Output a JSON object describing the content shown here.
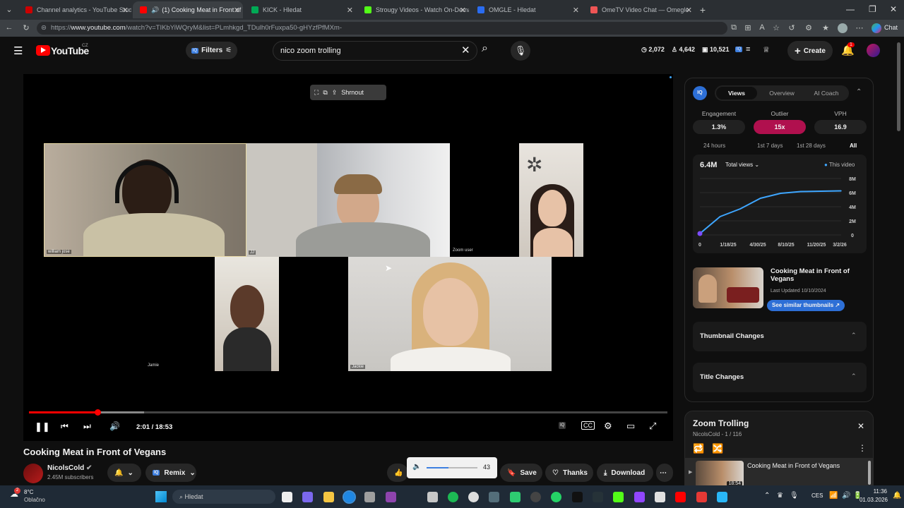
{
  "browser": {
    "tabs": [
      {
        "label": "Channel analytics - YouTube Studio",
        "color": "#c00"
      },
      {
        "label": "(1) Cooking Meat in Front of V",
        "color": "#f00",
        "active": true
      },
      {
        "label": "KICK - Hledat",
        "color": "#0a5"
      },
      {
        "label": "Strougy Videos - Watch On-Dema",
        "color": "#53fc18"
      },
      {
        "label": "OMGLE - Hledat",
        "color": "#2a6cf0"
      },
      {
        "label": "OmeTV Video Chat — Omegle",
        "color": "#e55"
      }
    ],
    "url_prefix": "https://",
    "url_host": "www.youtube.com",
    "url_path": "/watch?v=TIKbYiWQryM&list=PLmhkgd_TDulh0rFuxpa50-gHYzfPfMXm-",
    "chat_label": "Chat"
  },
  "yt": {
    "logo": "YouTube",
    "country": "CZ",
    "filters_label": "Filters",
    "search_value": "nico zoom trolling",
    "stats": {
      "a": "2,072",
      "b": "4,642",
      "c": "10,521"
    },
    "create_label": "Create",
    "notif_count": "1"
  },
  "player": {
    "share_label": "Shrnout",
    "time": "2:01 / 18:53",
    "progress": 0.107,
    "buffered": 0.18,
    "participants": {
      "p1": "william jose",
      "p2": "JJ",
      "p3": "Zoom user",
      "p4": "Jamie",
      "p5": "Jackie"
    }
  },
  "video": {
    "title": "Cooking Meat in Front of Vegans",
    "channel": "NicolsCold",
    "subscribers": "2.45M subscribers",
    "remix_label": "Remix",
    "volume_value": "43",
    "volume_level": 0.43,
    "save_label": "Save",
    "thanks_label": "Thanks",
    "download_label": "Download"
  },
  "iq": {
    "badge": "IQ",
    "tabs": [
      "Views",
      "Overview",
      "AI Coach"
    ],
    "stat_labels": [
      "Engagement",
      "Outlier",
      "VPH"
    ],
    "stat_values": [
      "1.3%",
      "15x",
      "16.9"
    ],
    "ranges": [
      "24 hours",
      "1st 7 days",
      "1st 28 days",
      "All"
    ],
    "total": "6.4M",
    "metric": "Total views",
    "legend": "This video",
    "chart_data": {
      "type": "line",
      "x": [
        "0",
        "1/18/25",
        "4/30/25",
        "8/10/25",
        "11/20/25",
        "3/2/26"
      ],
      "y_ticks": [
        "0",
        "2M",
        "4M",
        "6M",
        "8M"
      ],
      "series": [
        {
          "name": "This video",
          "values": [
            0.2,
            2.6,
            3.7,
            5.2,
            5.9,
            6.15,
            6.2,
            6.25
          ]
        }
      ],
      "ylim": [
        0,
        8
      ]
    },
    "related_title": "Cooking Meat in Front of Vegans",
    "related_updated": "Last Updated 10/10/2024",
    "similar_label": "See similar thumbnails",
    "thumb_changes": "Thumbnail Changes",
    "title_changes": "Title Changes"
  },
  "playlist": {
    "title": "Zoom Trolling",
    "meta": "NicolsCold - 1 / 116",
    "item_title": "Cooking Meat in Front of Vegans",
    "item_duration": "18:54"
  },
  "taskbar": {
    "weather_temp": "8°C",
    "weather_desc": "Oblačno",
    "search": "Hledat",
    "lang": "CES",
    "time": "11:36",
    "date": "01.03.2026"
  }
}
